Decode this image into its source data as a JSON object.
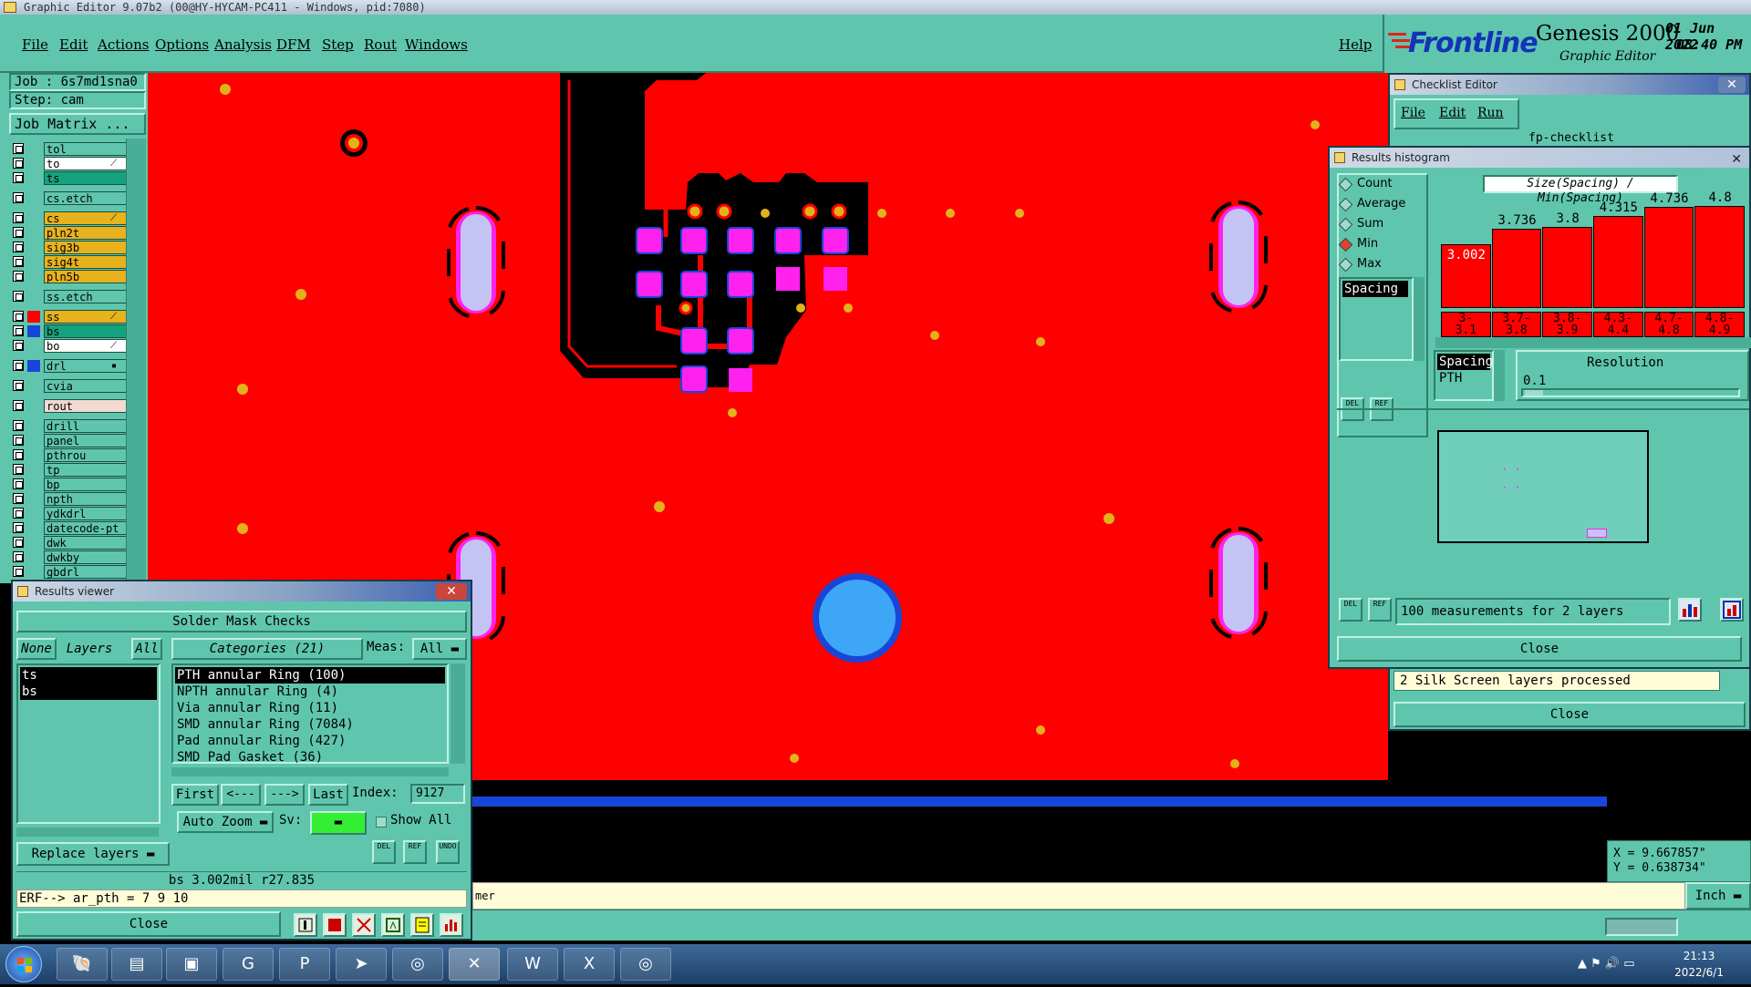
{
  "app": {
    "title": "Graphic Editor 9.07b2 (00@HY-HYCAM-PC411 - Windows, pid:7080)"
  },
  "menu": {
    "items": [
      "File",
      "Edit",
      "Actions",
      "Options",
      "Analysis",
      "DFM",
      "Step",
      "Rout",
      "Windows"
    ],
    "help": "Help"
  },
  "brand": {
    "logo": "Frontline",
    "product": "Genesis 2000",
    "subtitle": "Graphic Editor",
    "date": "01 Jun 2022",
    "time": "08:40 PM"
  },
  "job": {
    "job_label": "Job : 6s7md1sna0",
    "step_label": "Step: cam",
    "matrix_button": "Job Matrix ..."
  },
  "layers": [
    {
      "name": "tol",
      "color": "#5fc6ad",
      "mark": ""
    },
    {
      "name": "to",
      "color": "#ffffff",
      "mark": "⟋"
    },
    {
      "name": "ts",
      "color": "#15a37d",
      "mark": ""
    },
    {
      "name": "cs.etch",
      "color": "#5fc6ad",
      "mark": ""
    },
    {
      "name": "cs",
      "color": "#e7b21c",
      "mark": "⟋"
    },
    {
      "name": "pln2t",
      "color": "#e7b21c",
      "mark": ""
    },
    {
      "name": "sig3b",
      "color": "#e7b21c",
      "mark": ""
    },
    {
      "name": "sig4t",
      "color": "#e7b21c",
      "mark": ""
    },
    {
      "name": "pln5b",
      "color": "#e7b21c",
      "mark": ""
    },
    {
      "name": "ss.etch",
      "color": "#5fc6ad",
      "mark": ""
    },
    {
      "name": "ss",
      "color": "#e7b21c",
      "mark": "⟋"
    },
    {
      "name": "bs",
      "color": "#15a37d",
      "mark": ""
    },
    {
      "name": "bo",
      "color": "#ffffff",
      "mark": "⟋"
    },
    {
      "name": "drl",
      "color": "#5fc6ad",
      "mark": "▪"
    },
    {
      "name": "cvia",
      "color": "#5fc6ad",
      "mark": ""
    },
    {
      "name": "rout",
      "color": "#f2d9d2",
      "mark": ""
    },
    {
      "name": "drill",
      "color": "#5fc6ad",
      "mark": ""
    },
    {
      "name": "panel",
      "color": "#5fc6ad",
      "mark": ""
    },
    {
      "name": "pthrou",
      "color": "#5fc6ad",
      "mark": ""
    },
    {
      "name": "tp",
      "color": "#5fc6ad",
      "mark": ""
    },
    {
      "name": "bp",
      "color": "#5fc6ad",
      "mark": ""
    },
    {
      "name": "npth",
      "color": "#5fc6ad",
      "mark": ""
    },
    {
      "name": "ydkdrl",
      "color": "#5fc6ad",
      "mark": ""
    },
    {
      "name": "datecode-pt",
      "color": "#5fc6ad",
      "mark": ""
    },
    {
      "name": "dwk",
      "color": "#5fc6ad",
      "mark": ""
    },
    {
      "name": "dwkby",
      "color": "#5fc6ad",
      "mark": ""
    },
    {
      "name": "gbdrl",
      "color": "#5fc6ad",
      "mark": ""
    }
  ],
  "layer_swatches": [
    "",
    "",
    "",
    "",
    "",
    "",
    "",
    "",
    "",
    "",
    "#ff0000",
    "#1846d9",
    "",
    "#1846d9",
    "",
    "",
    "",
    "",
    "",
    "",
    "",
    "",
    "",
    "",
    "",
    "",
    ""
  ],
  "results_viewer": {
    "title": "Results viewer",
    "close_x": "✕",
    "header": "Solder Mask Checks",
    "none_btn": "None",
    "layers_label": "Layers",
    "all_btn": "All",
    "categories_label": "Categories (21)",
    "meas_label": "Meas:",
    "meas_value": "All",
    "layers_list": [
      "ts",
      "bs"
    ],
    "categories": [
      "PTH annular Ring (100)",
      "NPTH annular Ring (4)",
      "Via annular Ring (11)",
      "SMD annular Ring (7084)",
      "Pad annular Ring (427)",
      "SMD Pad Gasket (36)"
    ],
    "first_btn": "First",
    "prev_btn": "<---",
    "next_btn": "--->",
    "last_btn": "Last",
    "index_label": "Index:",
    "index_value": "9127",
    "zoom_option": "Auto Zoom",
    "sv_label": "Sv:",
    "show_all": "Show All",
    "replace_option": "Replace layers",
    "status_line": "bs 3.002mil  r27.835",
    "erf_line": "ERF--> ar_pth = 7 9 10",
    "close_btn": "Close",
    "del_btn": "DEL",
    "ref_btn": "REF",
    "undo_btn": "UNDO"
  },
  "checklist": {
    "title": "Checklist Editor",
    "menu": [
      "File",
      "Edit",
      "Run"
    ],
    "name": "fp-checklist",
    "status": "2 Silk Screen layers processed",
    "close_btn": "Close"
  },
  "histogram": {
    "title": "Results histogram",
    "modes": [
      "Count",
      "Average",
      "Sum",
      "Min",
      "Max"
    ],
    "selected_mode": "Min",
    "list_item": "Spacing",
    "chart_title": "Size(Spacing) / Min(Spacing)",
    "spacing_label": "Spacing",
    "pth_label": "PTH",
    "resolution_label": "Resolution",
    "resolution_value": "0.1",
    "measurements": "100 measurements for 2 layers",
    "close_btn": "Close",
    "del_btn": "DEL",
    "ref_btn": "REF"
  },
  "chart_data": {
    "type": "bar",
    "title": "Size(Spacing) / Min(Spacing)",
    "categories": [
      "3-\n3.1",
      "3.7-\n3.8",
      "3.8-\n3.9",
      "4.3-\n4.4",
      "4.7-\n4.8",
      "4.8-\n4.9"
    ],
    "values": [
      3.002,
      3.736,
      3.8,
      4.315,
      4.736,
      4.8
    ],
    "value_labels": [
      "3.002",
      "3.736",
      "3.8",
      "4.315",
      "4.736",
      "4.8"
    ],
    "ylim": [
      0,
      5.3
    ]
  },
  "coords": {
    "x": "X = 9.667857\"",
    "y": "Y = 0.638734\""
  },
  "message": {
    "text": "mer",
    "unit": "Inch"
  },
  "taskbar": {
    "time": "21:13",
    "date": "2022/6/1"
  },
  "colors": {
    "background_red": "#ff0000",
    "panel_teal": "#5fc6ad",
    "pad_magenta": "#ff22ee",
    "pad_blue": "#1846d9",
    "drill_yellow": "#e3b21a",
    "hole_lavender": "#c4c4f4"
  }
}
